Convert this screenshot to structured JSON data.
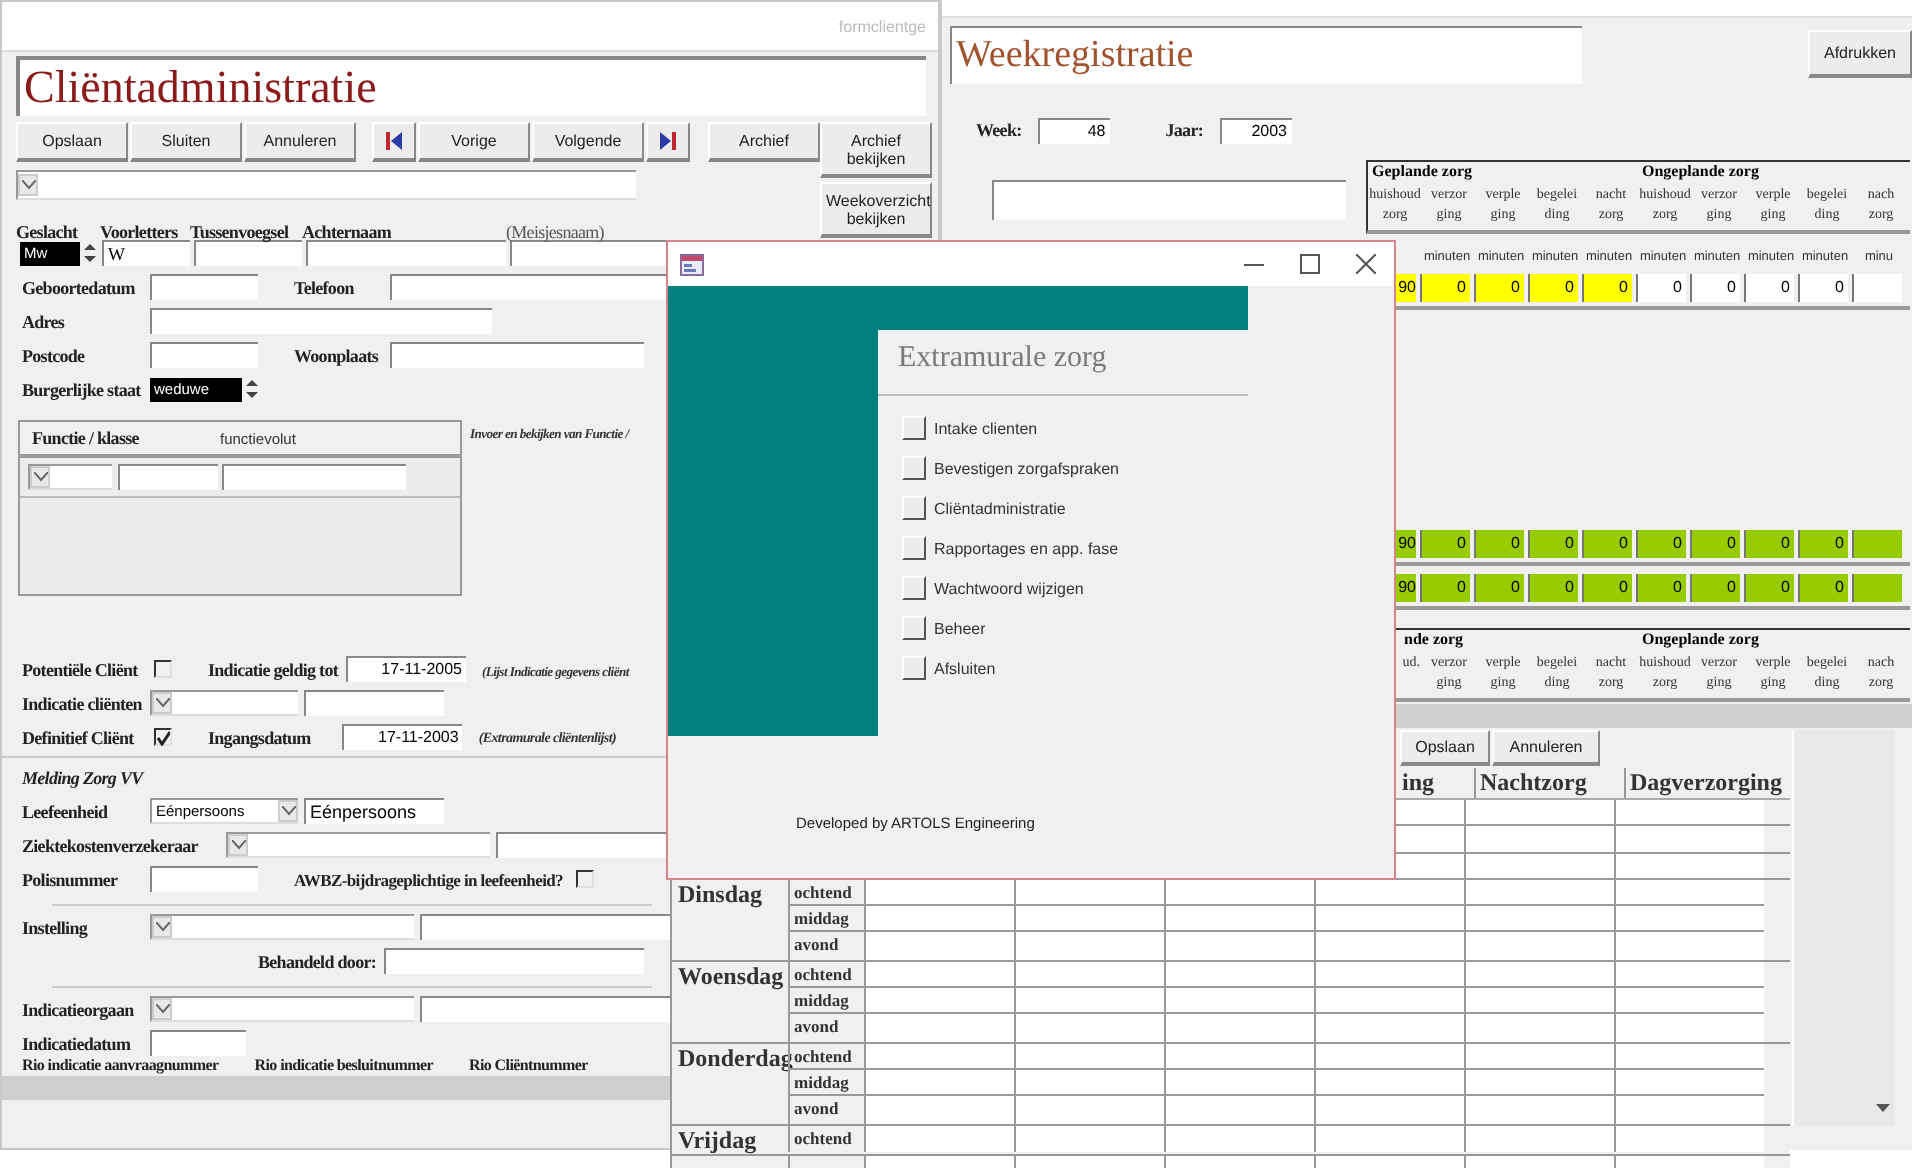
{
  "client_form": {
    "title": "formclientge",
    "heading": "Cliëntadministratie",
    "toolbar": [
      {
        "kind": "text",
        "label": "Opslaan"
      },
      {
        "kind": "text",
        "label": "Sluiten"
      },
      {
        "kind": "text",
        "label": "Annuleren"
      },
      {
        "kind": "first"
      },
      {
        "kind": "text",
        "label": "Vorige"
      },
      {
        "kind": "text",
        "label": "Volgende"
      },
      {
        "kind": "last"
      },
      {
        "kind": "text",
        "label": "Archief"
      }
    ],
    "side_buttons": [
      "Archief bekijken",
      "Weekoverzicht bekijken"
    ],
    "name_labels": [
      "Geslacht",
      "Voorletters",
      "Tussenvoegsel",
      "Achternaam",
      "(Meisjesnaam)"
    ],
    "gender": "Mw",
    "initials": "W",
    "labels": {
      "birthdate": "Geboortedatum",
      "phone": "Telefoon",
      "address": "Adres",
      "postcode": "Postcode",
      "city": "Woonplaats",
      "marital": "Burgerlijke staat"
    },
    "marital_value": "weduwe",
    "function_subform": {
      "columns": [
        "Functie / klasse",
        "functievolut"
      ],
      "note": "Invoer en bekijken van Functie /"
    },
    "potential": {
      "label": "Potentiële Cliënt",
      "checked": false
    },
    "valid_until": {
      "label": "Indicatie geldig tot",
      "value": "17-11-2005",
      "note": "(Lijst Indicatie gegevens cliënt"
    },
    "indication_clients": "Indicatie cliënten",
    "definitive": {
      "label": "Definitief Cliënt",
      "checked": true
    },
    "start_date": {
      "label": "Ingangsdatum",
      "value": "17-11-2003",
      "note": "(Extramurale cliëntenlijst)"
    },
    "section": "Melding Zorg VV",
    "household": {
      "label": "Leefeenheid",
      "value": "Eénpersoons",
      "value2": "Eénpersoons"
    },
    "insurer": "Ziektekostenverzekeraar",
    "policy": "Polisnummer",
    "awbz": {
      "label": "AWBZ-bijdrageplichtige in leefeenheid?",
      "checked": false
    },
    "institution": "Instelling",
    "handled_by": "Behandeld door:",
    "indication_body": "Indicatieorgaan",
    "indication_date": "Indicatiedatum",
    "rio_labels": [
      "Rio indicatie aanvraagnummer",
      "Rio indicatie besluitnummer",
      "Rio Cliëntnummer"
    ]
  },
  "week_form": {
    "heading": "Weekregistratie",
    "print_button": "Afdrukken",
    "week": {
      "label": "Week:",
      "value": "48"
    },
    "year": {
      "label": "Jaar:",
      "value": "2003"
    },
    "groups": [
      "Geplande zorg",
      "Ongeplande zorg"
    ],
    "columns": [
      "huishoud zorg",
      "verzor ging",
      "verple ging",
      "begelei ding",
      "nacht zorg",
      "huishoud zorg",
      "verzor ging",
      "verple ging",
      "begelei ding",
      "nach zorg"
    ],
    "units": [
      "minuten",
      "minuten",
      "minuten",
      "minuten",
      "minuten",
      "minuten",
      "minuten",
      "minuten",
      "minu"
    ],
    "rows": [
      {
        "cells": [
          {
            "value": "90",
            "color": "#ffff00"
          },
          {
            "value": "0",
            "color": "#ffff00"
          },
          {
            "value": "0",
            "color": "#ffff00"
          },
          {
            "value": "0",
            "color": "#ffff00"
          },
          {
            "value": "0",
            "color": "#ffff00"
          },
          {
            "value": "0",
            "color": "#ffffff"
          },
          {
            "value": "0",
            "color": "#ffffff"
          },
          {
            "value": "0",
            "color": "#ffffff"
          },
          {
            "value": "0",
            "color": "#ffffff"
          },
          {
            "color": "#ffffff"
          }
        ]
      },
      {
        "cells": [
          {
            "value": "90",
            "color": "#99cc00"
          },
          {
            "value": "0",
            "color": "#99cc00"
          },
          {
            "value": "0",
            "color": "#99cc00"
          },
          {
            "value": "0",
            "color": "#99cc00"
          },
          {
            "value": "0",
            "color": "#99cc00"
          },
          {
            "value": "0",
            "color": "#99cc00"
          },
          {
            "value": "0",
            "color": "#99cc00"
          },
          {
            "value": "0",
            "color": "#99cc00"
          },
          {
            "value": "0",
            "color": "#99cc00"
          },
          {
            "color": "#99cc00"
          }
        ]
      },
      {
        "cells": [
          {
            "value": "90",
            "color": "#99cc00"
          },
          {
            "value": "0",
            "color": "#99cc00"
          },
          {
            "value": "0",
            "color": "#99cc00"
          },
          {
            "value": "0",
            "color": "#99cc00"
          },
          {
            "value": "0",
            "color": "#99cc00"
          },
          {
            "value": "0",
            "color": "#99cc00"
          },
          {
            "value": "0",
            "color": "#99cc00"
          },
          {
            "value": "0",
            "color": "#99cc00"
          },
          {
            "value": "0",
            "color": "#99cc00"
          },
          {
            "color": "#99cc00"
          }
        ]
      }
    ],
    "lower_groups": [
      "nde zorg",
      "Ongeplande zorg"
    ],
    "lower_columns": [
      "ud.",
      "verzor ging",
      "verple ging",
      "begelei ding",
      "nacht zorg",
      "huishoud zorg",
      "verzor ging",
      "verple ging",
      "begelei ding",
      "nach zorg"
    ]
  },
  "schedule": {
    "buttons": [
      "Opslaan",
      "Annuleren"
    ],
    "columns": [
      "ing",
      "Nachtzorg",
      "Dagverzorging"
    ],
    "days": [
      {
        "day": "Dinsdag",
        "parts": [
          "ochtend",
          "middag",
          "avond"
        ]
      },
      {
        "day": "Woensdag",
        "parts": [
          "ochtend",
          "middag",
          "avond"
        ]
      },
      {
        "day": "Donderdag",
        "parts": [
          "ochtend",
          "middag",
          "avond"
        ]
      },
      {
        "day": "Vrijdag",
        "parts": [
          "ochtend"
        ]
      }
    ]
  },
  "menu_dialog": {
    "heading": "Extramurale zorg",
    "items": [
      "Intake clienten",
      "Bevestigen zorgafspraken",
      "Cliëntadministratie",
      "Rapportages en app. fase",
      "Wachtwoord wijzigen",
      "Beheer",
      "Afsluiten"
    ],
    "footer": "Developed by ARTOLS Engineering"
  }
}
